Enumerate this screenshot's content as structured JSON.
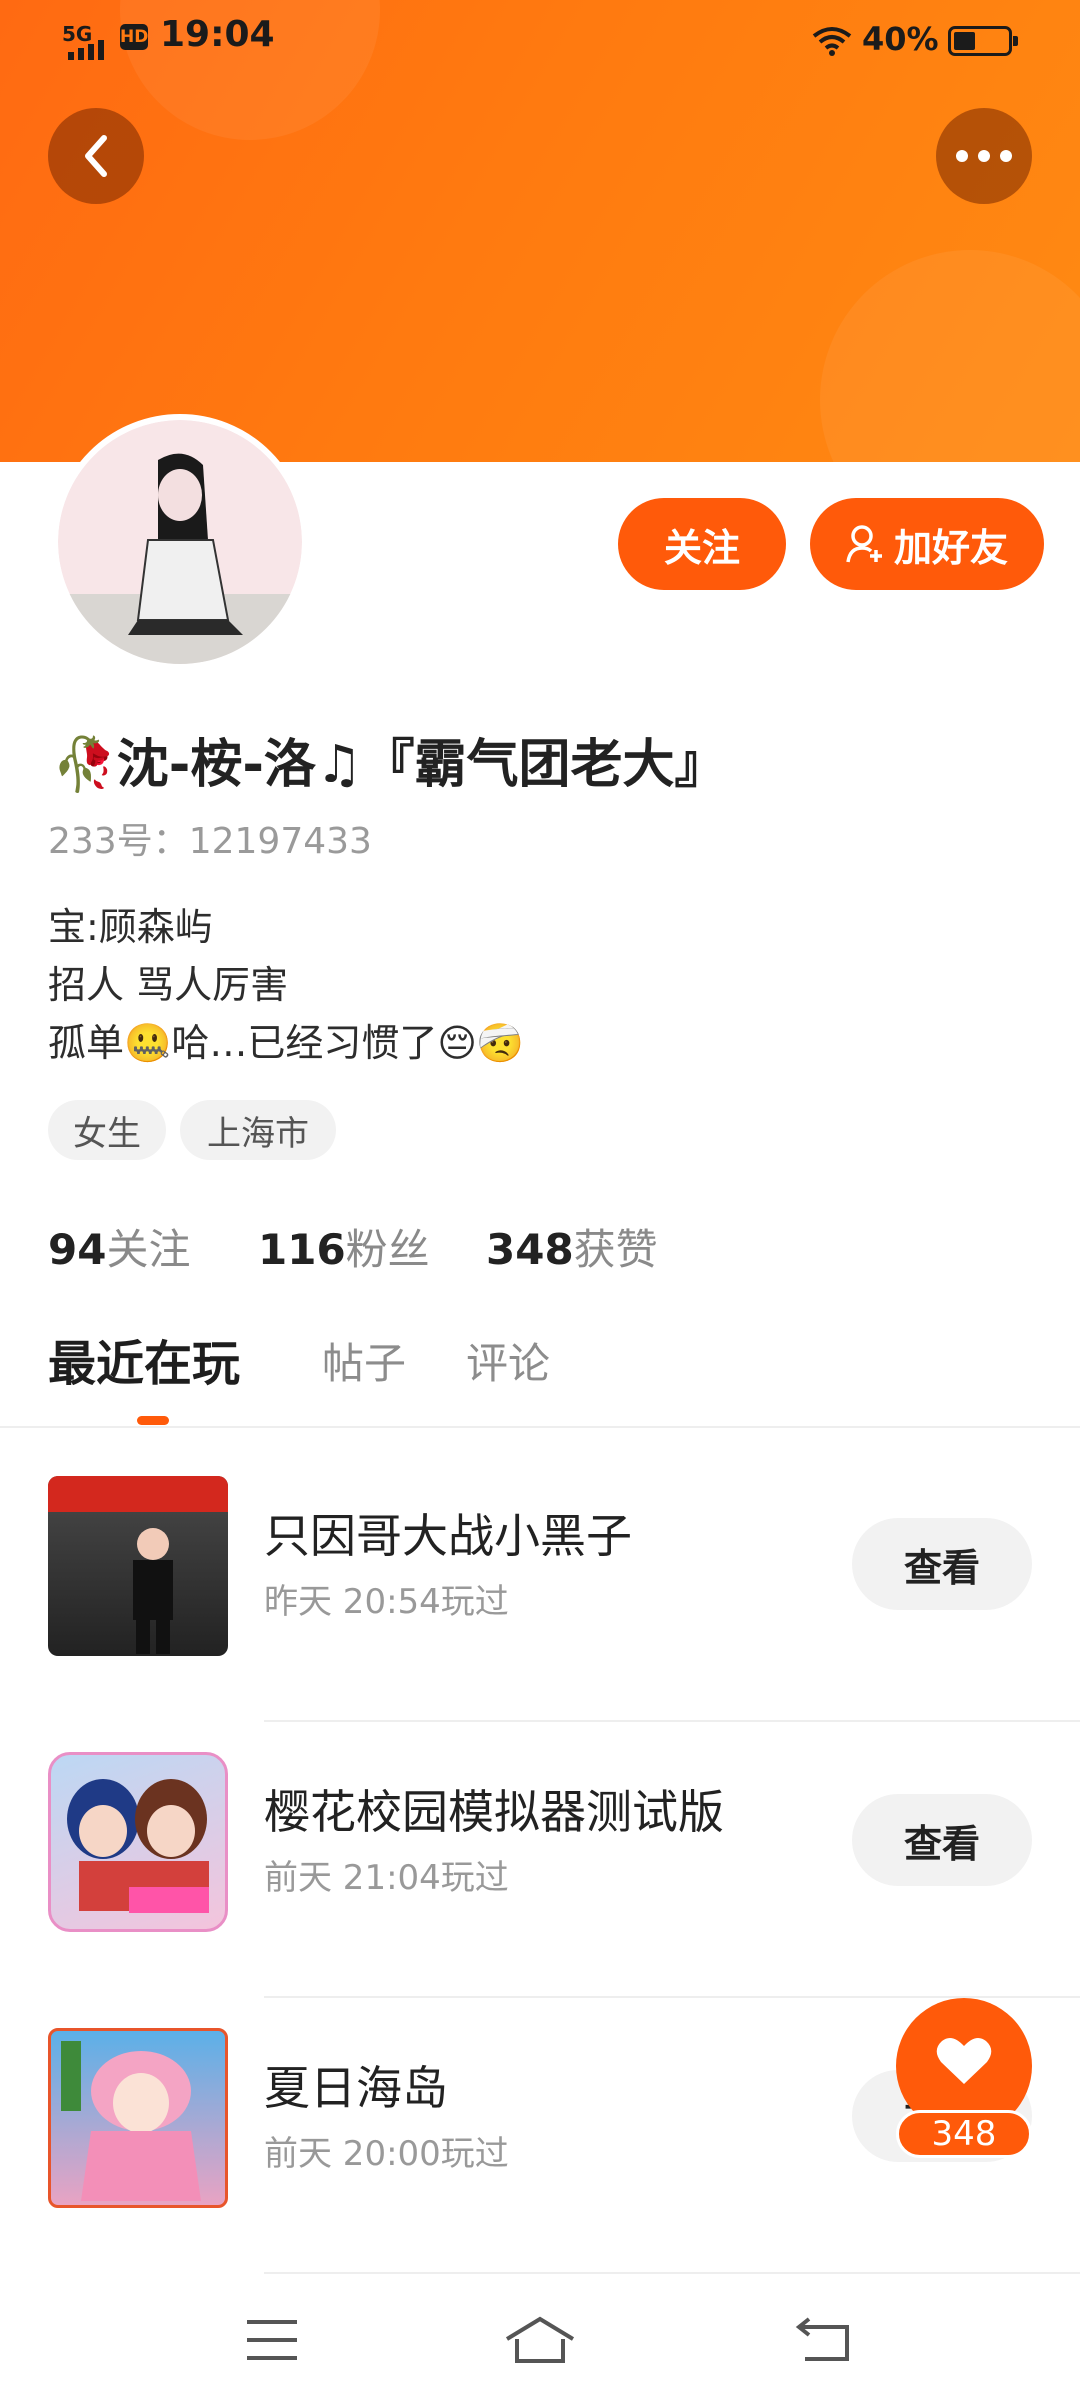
{
  "status_bar": {
    "time": "19:04",
    "network": "5G",
    "hd": "HD",
    "battery_percent": "40%",
    "battery_level": 0.4
  },
  "header": {
    "back_icon": "chevron-left-icon",
    "more_icon": "more-dots-icon",
    "color": "#ff7a10"
  },
  "profile": {
    "follow_label": "关注",
    "add_friend_label": "加好友",
    "name": "🥀沈-桉-洛♫『霸气团老大』",
    "uid": "233号：12197433",
    "bio": "宝:顾森屿\n招人 骂人厉害\n孤单🤐哈…已经习惯了😔🤕",
    "tags": [
      "女生",
      "上海市"
    ],
    "stats": [
      {
        "num": "94",
        "label": "关注"
      },
      {
        "num": "116",
        "label": "粉丝"
      },
      {
        "num": "348",
        "label": "获赞"
      }
    ]
  },
  "tabs": [
    "最近在玩",
    "帖子",
    "评论"
  ],
  "games": [
    {
      "title": "只因哥大战小黑子",
      "time": "昨天 20:54玩过",
      "button": "查看"
    },
    {
      "title": "樱花校园模拟器测试版",
      "time": "前天 21:04玩过",
      "button": "查看"
    },
    {
      "title": "夏日海岛",
      "time": "前天 20:00玩过",
      "button": "查看"
    }
  ],
  "like": {
    "count": "348"
  },
  "accent_color": "#ff5a0a"
}
